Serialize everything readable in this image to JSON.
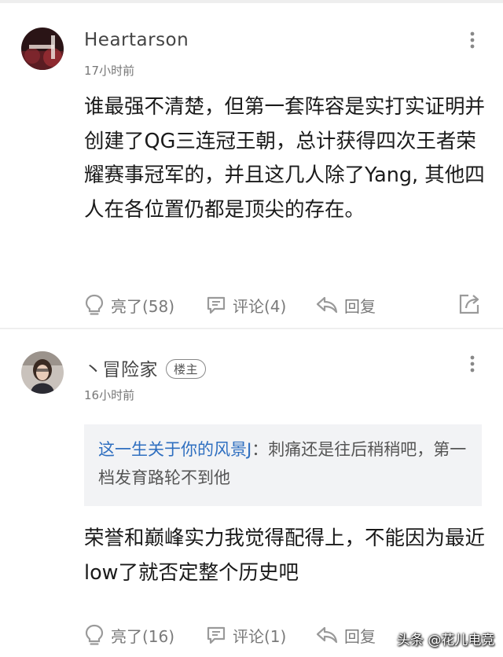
{
  "comments": [
    {
      "username": "Heartarson",
      "time": "17小时前",
      "text": "谁最强不清楚，但第一套阵容是实打实证明并创建了QG三连冠王朝，总计获得四次王者荣耀赛事冠军的，并且这几人除了Yang, 其他四人在各位置仍都是顶尖的存在。",
      "like_label": "亮了(58)",
      "comment_label": "评论(4)",
      "reply_label": "回复"
    },
    {
      "username": "丶冒险家",
      "badge": "楼主",
      "time": "16小时前",
      "quote_author": "这一生关于你的风景J",
      "quote_text": "：刺痛还是往后稍稍吧，第一档发育路轮不到他",
      "text": "荣誉和巅峰实力我觉得配得上，不能因为最近low了就否定整个历史吧",
      "like_label": "亮了(16)",
      "comment_label": "评论(1)",
      "reply_label": "回复"
    }
  ],
  "watermark": "头条 @花儿电竞",
  "icons": [
    "more-vertical-icon",
    "lightbulb-icon",
    "comment-bubble-icon",
    "reply-arrow-icon",
    "share-icon"
  ],
  "colors": {
    "quote_author": "#2f6fc0",
    "quote_bg": "#f2f3f5",
    "action_text": "#7a7a7a"
  }
}
